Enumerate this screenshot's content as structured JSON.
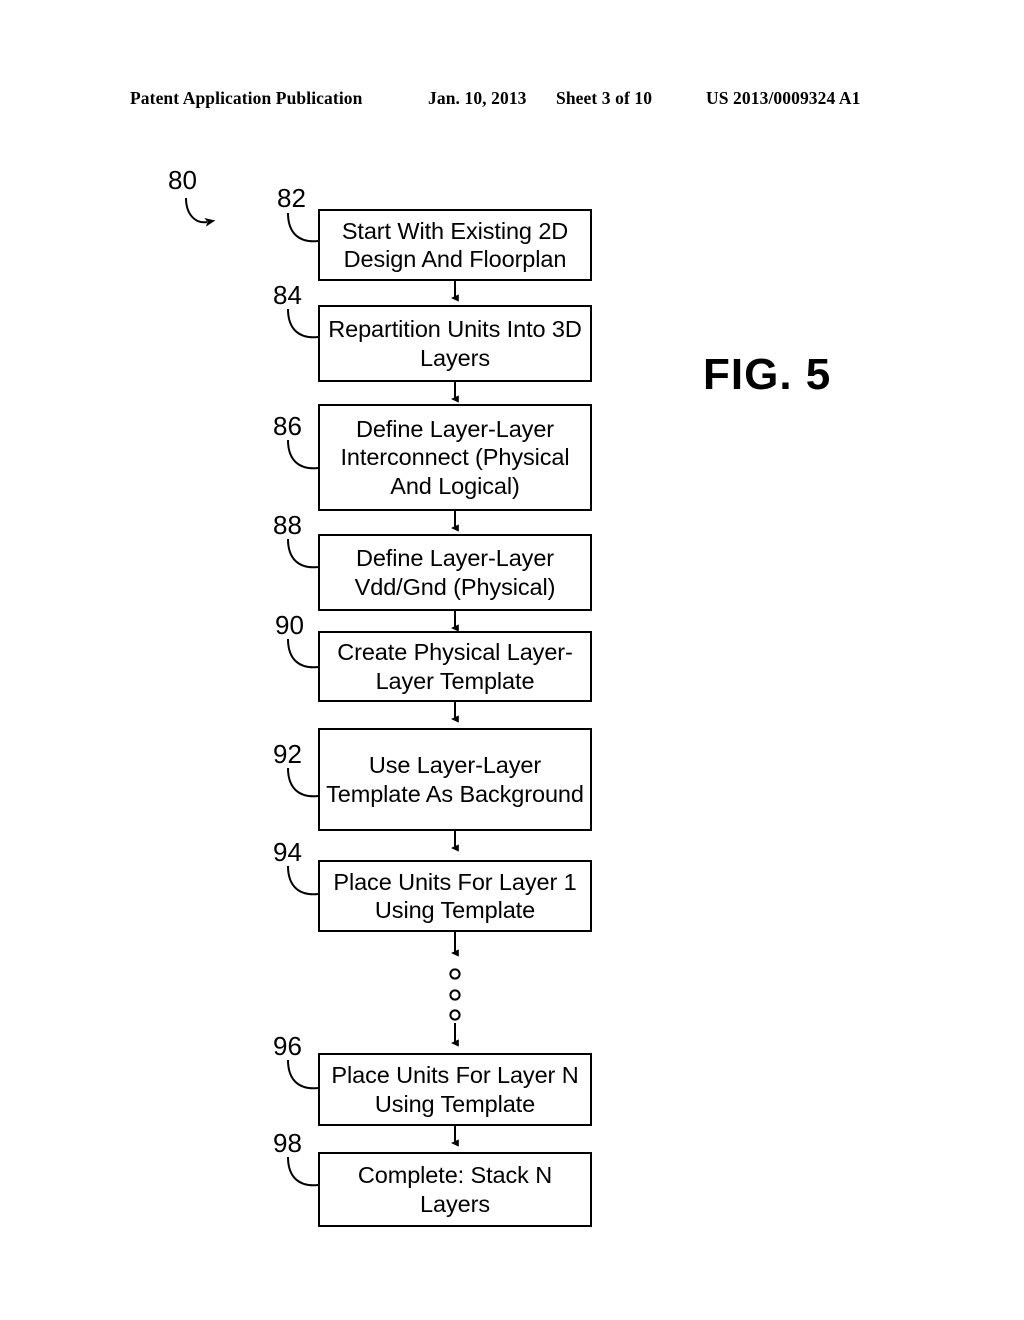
{
  "header": {
    "publication": "Patent Application Publication",
    "date": "Jan. 10, 2013",
    "sheet": "Sheet 3 of 10",
    "number": "US 2013/0009324 A1"
  },
  "figure": {
    "caption": "FIG. 5",
    "diagram_ref": "80"
  },
  "flowchart": {
    "steps": [
      {
        "ref": "82",
        "text": "Start With Existing 2D Design And Floorplan"
      },
      {
        "ref": "84",
        "text": "Repartition Units Into 3D Layers"
      },
      {
        "ref": "86",
        "text": "Define Layer-Layer Interconnect (Physical And Logical)"
      },
      {
        "ref": "88",
        "text": "Define Layer-Layer Vdd/Gnd (Physical)"
      },
      {
        "ref": "90",
        "text": "Create Physical Layer-Layer Template"
      },
      {
        "ref": "92",
        "text": "Use Layer-Layer Template As Background"
      },
      {
        "ref": "94",
        "text": "Place Units For Layer 1 Using Template"
      },
      {
        "ref": "96",
        "text": "Place Units For Layer N Using Template"
      },
      {
        "ref": "98",
        "text": "Complete:  Stack N Layers"
      }
    ],
    "continuation_marker": "vertical-ellipsis-three-circles"
  },
  "colors": {
    "ink": "#000000",
    "paper": "#ffffff"
  }
}
